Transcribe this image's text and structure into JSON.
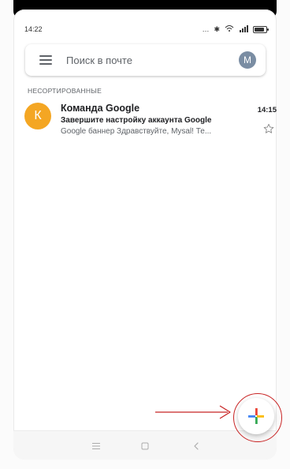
{
  "status_bar": {
    "time": "14:22"
  },
  "search": {
    "placeholder": "Поиск в почте",
    "account_initial": "M"
  },
  "inbox": {
    "section_label": "НЕСОРТИРОВАННЫЕ",
    "emails": [
      {
        "sender_initial": "К",
        "sender": "Команда Google",
        "subject": "Завершите настройку аккаунта Google",
        "snippet": "Google баннер Здравствуйте, Mysal! Те...",
        "time": "14:15"
      }
    ]
  },
  "fab": {
    "label": "+"
  },
  "icons": {
    "menu": "hamburger-icon",
    "star": "star-outline-icon",
    "nav_menu": "menu-icon",
    "nav_home": "home-square-icon",
    "nav_back": "back-chevron-icon"
  },
  "colors": {
    "avatar_k": "#f4a623",
    "avatar_m": "#7a8da3",
    "annotation_red": "#c82424"
  }
}
